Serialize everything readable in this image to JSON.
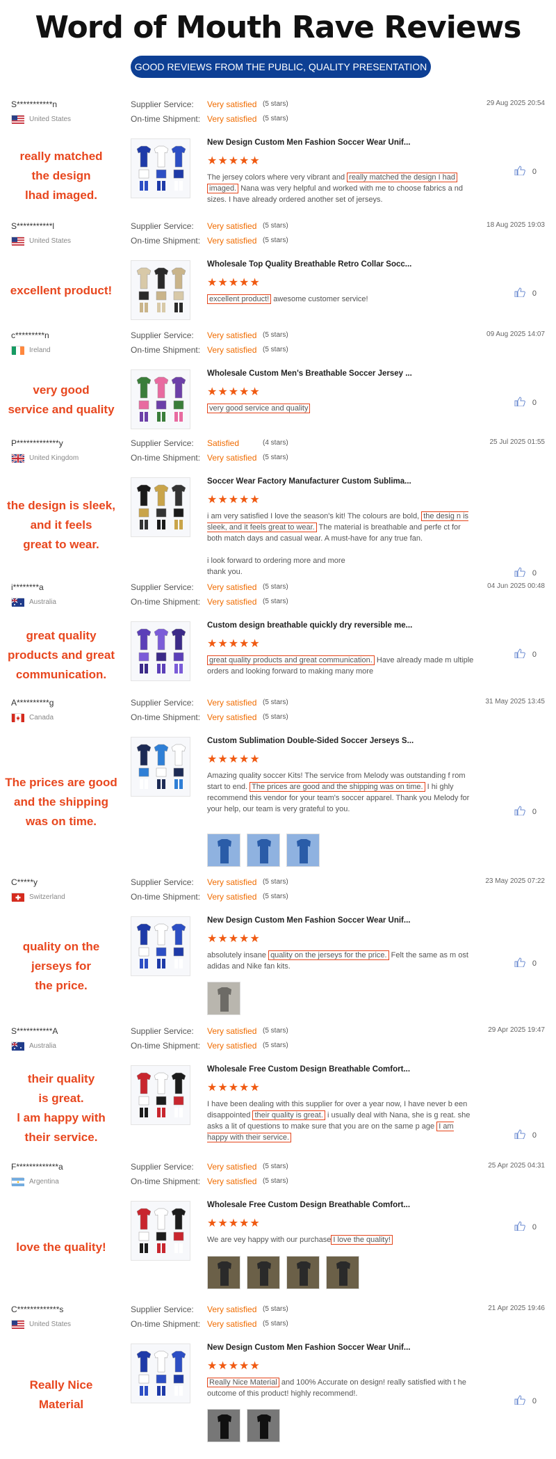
{
  "header": {
    "title": "Word of Mouth Rave Reviews",
    "subtitle": "GOOD REVIEWS FROM THE PUBLIC, QUALITY PRESENTATION"
  },
  "labels": {
    "supplier": "Supplier Service:",
    "shipment": "On-time Shipment:"
  },
  "colors": {
    "accent": "#e8471e",
    "pill": "#0d3f94",
    "orange": "#f06c00"
  },
  "reviews": [
    {
      "user": "S***********n",
      "country": "United States",
      "flag": "us",
      "highlight": "really matched\nthe design\nlhad imaged.",
      "supplier": "Very satisfied",
      "supplier_stars": "(5 stars)",
      "shipment": "Very satisfied",
      "shipment_stars": "(5 stars)",
      "date": "29 Aug 2025 20:54",
      "product": "New Design Custom Men Fashion Soccer Wear Unif...",
      "stars": "★★★★★",
      "text": [
        {
          "t": "The jersey colors where very vibrant and "
        },
        {
          "t": "really matched the design I had",
          "m": true
        },
        {
          "t": " "
        },
        {
          "t": "imaged.",
          "m": true
        },
        {
          "t": " Nana was very helpful and worked with me to choose fabrics a nd sizes. I have already ordered another set of jerseys."
        }
      ],
      "likes": "0",
      "photos": [],
      "thumb": "blue"
    },
    {
      "user": "S***********l",
      "country": "United States",
      "flag": "us",
      "highlight": "excellent product!",
      "supplier": "Very satisfied",
      "supplier_stars": "(5 stars)",
      "shipment": "Very satisfied",
      "shipment_stars": "(5 stars)",
      "date": "18 Aug 2025 19:03",
      "product": "Wholesale Top Quality Breathable Retro Collar Socc...",
      "stars": "★★★★★",
      "text": [
        {
          "t": "excellent product!",
          "m": true
        },
        {
          "t": " awesome customer service!"
        }
      ],
      "likes": "0",
      "photos": [],
      "thumb": "beige"
    },
    {
      "user": "c*********n",
      "country": "Ireland",
      "flag": "ie",
      "highlight": "very good\nservice and quality",
      "supplier": "Very satisfied",
      "supplier_stars": "(5 stars)",
      "shipment": "Very satisfied",
      "shipment_stars": "(5 stars)",
      "date": "09 Aug 2025 14:07",
      "product": "Wholesale Custom Men's Breathable Soccer Jersey ...",
      "stars": "★★★★★",
      "text": [
        {
          "t": "very good service and quality",
          "m": true
        }
      ],
      "likes": "0",
      "photos": [],
      "thumb": "multi"
    },
    {
      "user": "P*************y",
      "country": "United Kingdom",
      "flag": "uk",
      "highlight": "the design is sleek,\nand it feels\ngreat to wear.",
      "supplier": "Satisfied",
      "supplier_stars": "(4 stars)",
      "shipment": "Very satisfied",
      "shipment_stars": "(5 stars)",
      "date": "25 Jul 2025 01:55",
      "product": "Soccer Wear Factory Manufacturer Custom Sublima...",
      "stars": "★★★★★",
      "text": [
        {
          "t": "i am very satisfied I love the season's kit! The colours are bold, "
        },
        {
          "t": "the desig n is sleek, and it feels great to wear.",
          "m": true
        },
        {
          "t": " The material is breathable and perfe ct for both match days and casual wear. A must-have for any true fan."
        },
        {
          "br": true
        },
        {
          "br": true
        },
        {
          "t": "i look forward to ordering more and more"
        },
        {
          "br": true
        },
        {
          "t": "thank you."
        }
      ],
      "likes": "0",
      "photos": [],
      "thumb": "black"
    },
    {
      "user": "i********a",
      "country": "Australia",
      "flag": "au",
      "highlight": "great quality\nproducts and great\ncommunication.",
      "supplier": "Very satisfied",
      "supplier_stars": "(5 stars)",
      "shipment": "Very satisfied",
      "shipment_stars": "(5 stars)",
      "date": "04 Jun 2025 00:48",
      "product": "Custom design breathable quickly dry reversible me...",
      "stars": "★★★★★",
      "text": [
        {
          "t": "great quality products and great communication.",
          "m": true
        },
        {
          "t": " Have already made m ultiple orders and looking forward to making many more"
        }
      ],
      "likes": "0",
      "photos": [],
      "thumb": "purple"
    },
    {
      "user": "A**********g",
      "country": "Canada",
      "flag": "ca",
      "highlight": "The prices are good\nand the shipping\nwas on time.",
      "supplier": "Very satisfied",
      "supplier_stars": "(5 stars)",
      "shipment": "Very satisfied",
      "shipment_stars": "(5 stars)",
      "date": "31 May 2025 13:45",
      "product": "Custom Sublimation Double-Sided Soccer Jerseys S...",
      "stars": "★★★★★",
      "text": [
        {
          "t": "Amazing quality soccer Kits! The service from Melody was outstanding f rom start to end. "
        },
        {
          "t": "The prices are good and the shipping was on time.",
          "m": true
        },
        {
          "t": " I hi ghly recommend this vendor for your team's soccer apparel. Thank you Melody for your help, our team is very grateful to you."
        }
      ],
      "likes": "0",
      "photos": [
        "blue",
        "blue",
        "blue"
      ],
      "thumb": "navy"
    },
    {
      "user": "C*****y",
      "country": "Switzerland",
      "flag": "ch",
      "highlight": "quality on the\njerseys for\nthe price.",
      "supplier": "Very satisfied",
      "supplier_stars": "(5 stars)",
      "shipment": "Very satisfied",
      "shipment_stars": "(5 stars)",
      "date": "23 May 2025 07:22",
      "product": "New Design Custom Men Fashion Soccer Wear Unif...",
      "stars": "★★★★★",
      "text": [
        {
          "t": "absolutely insane "
        },
        {
          "t": "quality on the jerseys for the price.",
          "m": true
        },
        {
          "t": " Felt the same as m ost adidas and Nike fan kits."
        }
      ],
      "likes": "0",
      "photos": [
        "grey"
      ],
      "thumb": "blue"
    },
    {
      "user": "S***********A",
      "country": "Australia",
      "flag": "au",
      "highlight": "their quality\nis great.\nl am happy with\ntheir service.",
      "supplier": "Very satisfied",
      "supplier_stars": "(5 stars)",
      "shipment": "Very satisfied",
      "shipment_stars": "(5 stars)",
      "date": "29 Apr 2025 19:47",
      "product": "Wholesale Free Custom Design Breathable Comfort...",
      "stars": "★★★★★",
      "text": [
        {
          "t": "I have been dealing with this supplier for over a year now, I have never b een disappointed "
        },
        {
          "t": "their quality is great.",
          "m": true
        },
        {
          "t": " i usually deal with Nana, she is g reat. she asks a lit of questions to make sure that you are on the same p age "
        },
        {
          "t": "I am happy with their service.",
          "m": true
        }
      ],
      "likes": "0",
      "photos": [],
      "thumb": "red"
    },
    {
      "user": "F*************a",
      "country": "Argentina",
      "flag": "ar",
      "highlight": "love the quality!",
      "supplier": "Very satisfied",
      "supplier_stars": "(5 stars)",
      "shipment": "Very satisfied",
      "shipment_stars": "(5 stars)",
      "date": "25 Apr 2025 04:31",
      "product": "Wholesale Free Custom Design Breathable Comfort...",
      "stars": "★★★★★",
      "text": [
        {
          "t": "We are vey happy with our purchase"
        },
        {
          "t": "I love the quality!",
          "m": true
        }
      ],
      "likes": "0",
      "photos": [
        "dark",
        "dark",
        "dark",
        "dark"
      ],
      "thumb": "red"
    },
    {
      "user": "C*************s",
      "country": "United States",
      "flag": "us",
      "highlight": "Really Nice\nMaterial",
      "supplier": "Very satisfied",
      "supplier_stars": "(5 stars)",
      "shipment": "Very satisfied",
      "shipment_stars": "(5 stars)",
      "date": "21 Apr 2025 19:46",
      "product": "New Design Custom Men Fashion Soccer Wear Unif...",
      "stars": "★★★★★",
      "text": [
        {
          "t": "Really Nice Material",
          "m": true
        },
        {
          "t": " and 100% Accurate on design! really satisfied with t he outcome of this product! highly recommend!."
        }
      ],
      "likes": "0",
      "photos": [
        "black",
        "black"
      ],
      "thumb": "blue"
    }
  ]
}
